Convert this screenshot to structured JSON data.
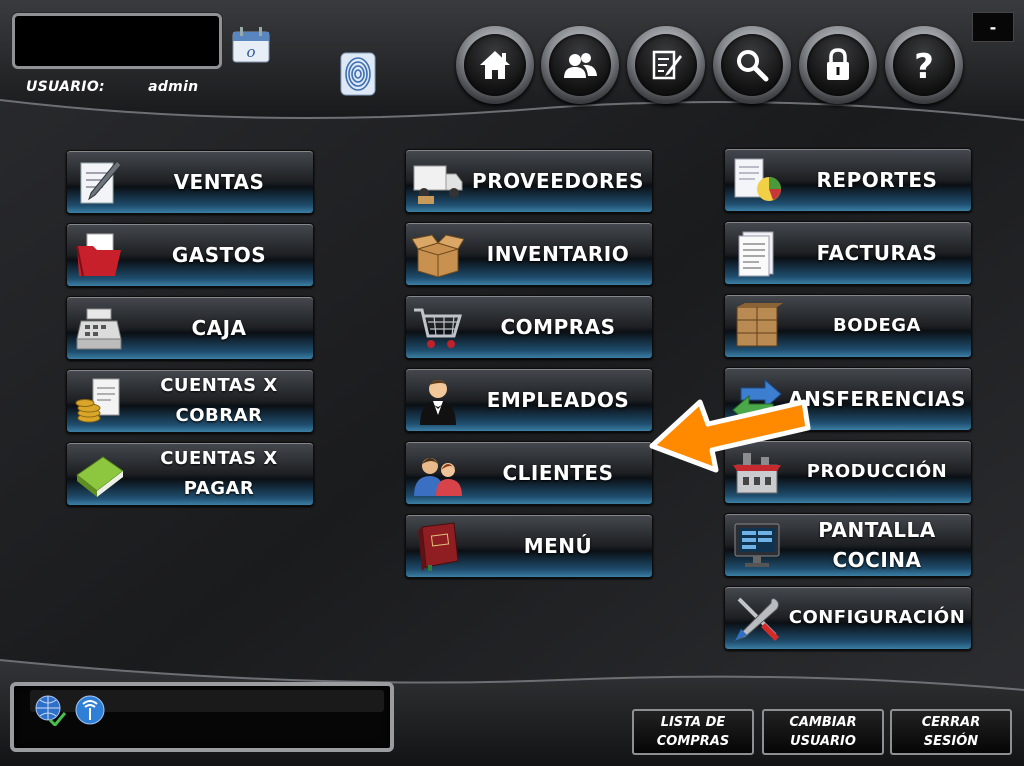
{
  "header": {
    "user_label": "USUARIO:",
    "user_name": "admin",
    "minimize_label": "-",
    "nav_icons": [
      "home-icon",
      "users-icon",
      "edit-icon",
      "search-icon",
      "lock-icon",
      "help-icon"
    ]
  },
  "menu": {
    "col1": [
      {
        "label": "VENTAS",
        "icon": "pen-document-icon"
      },
      {
        "label": "GASTOS",
        "icon": "red-folder-icon"
      },
      {
        "label": "CAJA",
        "icon": "cash-register-icon"
      },
      {
        "label": "CUENTAS X\nCOBRAR",
        "icon": "coins-invoice-icon"
      },
      {
        "label": "CUENTAS X\nPAGAR",
        "icon": "green-book-icon"
      }
    ],
    "col2": [
      {
        "label": "PROVEEDORES",
        "icon": "delivery-truck-icon"
      },
      {
        "label": "INVENTARIO",
        "icon": "box-icon"
      },
      {
        "label": "COMPRAS",
        "icon": "shopping-cart-icon"
      },
      {
        "label": "EMPLEADOS",
        "icon": "waiter-icon"
      },
      {
        "label": "CLIENTES",
        "icon": "customers-icon"
      },
      {
        "label": "MENÚ",
        "icon": "menu-book-icon"
      }
    ],
    "col3": [
      {
        "label": "REPORTES",
        "icon": "report-chart-icon"
      },
      {
        "label": "FACTURAS",
        "icon": "invoice-icon"
      },
      {
        "label": "BODEGA",
        "icon": "warehouse-boxes-icon"
      },
      {
        "label": "ANSFERENCIAS",
        "icon": "transfer-arrows-icon"
      },
      {
        "label": "PRODUCCIÓN",
        "icon": "factory-icon"
      },
      {
        "label": "PANTALLA\nCOCINA",
        "icon": "kitchen-screen-icon"
      },
      {
        "label": "CONFIGURACIÓN",
        "icon": "tools-icon"
      }
    ]
  },
  "footer": {
    "lista_compras": "LISTA DE\nCOMPRAS",
    "cambiar_usuario": "CAMBIAR\nUSUARIO",
    "cerrar_sesion": "CERRAR\nSESIÓN"
  },
  "colors": {
    "tile_blue": "#3c7fa5",
    "arrow_orange": "#ff8a00",
    "background": "#1c1d1f"
  }
}
